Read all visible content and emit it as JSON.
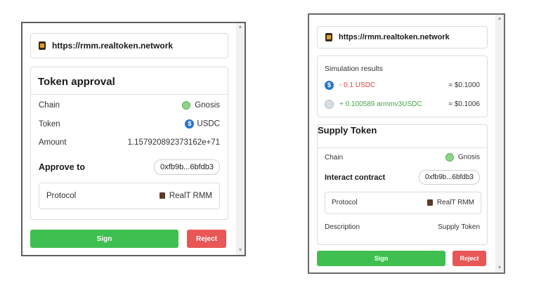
{
  "left_popup": {
    "url": "https://rmm.realtoken.network",
    "card_title": "Token approval",
    "rows": {
      "chain_label": "Chain",
      "chain_value": "Gnosis",
      "token_label": "Token",
      "token_value": "USDC",
      "amount_label": "Amount",
      "amount_value": "1.157920892373162e+71"
    },
    "approve_to_label": "Approve to",
    "approve_to_address": "0xfb9b...6bfdb3",
    "protocol_label": "Protocol",
    "protocol_value": "RealT RMM",
    "sign_label": "Sign",
    "reject_label": "Reject"
  },
  "right_popup": {
    "url": "https://rmm.realtoken.network",
    "simulation_title": "Simulation results",
    "simulation": [
      {
        "change": "- 0.1 USDC",
        "usd": "≈ $0.1000",
        "kind": "negative"
      },
      {
        "change": "+ 0.100589 armmv3USDC",
        "usd": "≈ $0.1006",
        "kind": "positive"
      }
    ],
    "card_title": "Supply Token",
    "chain_label": "Chain",
    "chain_value": "Gnosis",
    "interact_label": "Interact contract",
    "interact_address": "0xfb9b...6bfdb3",
    "protocol_label": "Protocol",
    "protocol_value": "RealT RMM",
    "description_label": "Description",
    "description_value": "Supply Token",
    "sign_label": "Sign",
    "reject_label": "Reject"
  },
  "icons": {
    "site_favicon": "realtoken-house-icon",
    "gnosis": "gnosis-icon",
    "usdc": "usdc-icon",
    "armm": "armm-token-icon"
  },
  "colors": {
    "sign": "#3fbf4f",
    "reject": "#e85656",
    "negative": "#e04040",
    "positive": "#43a548"
  }
}
